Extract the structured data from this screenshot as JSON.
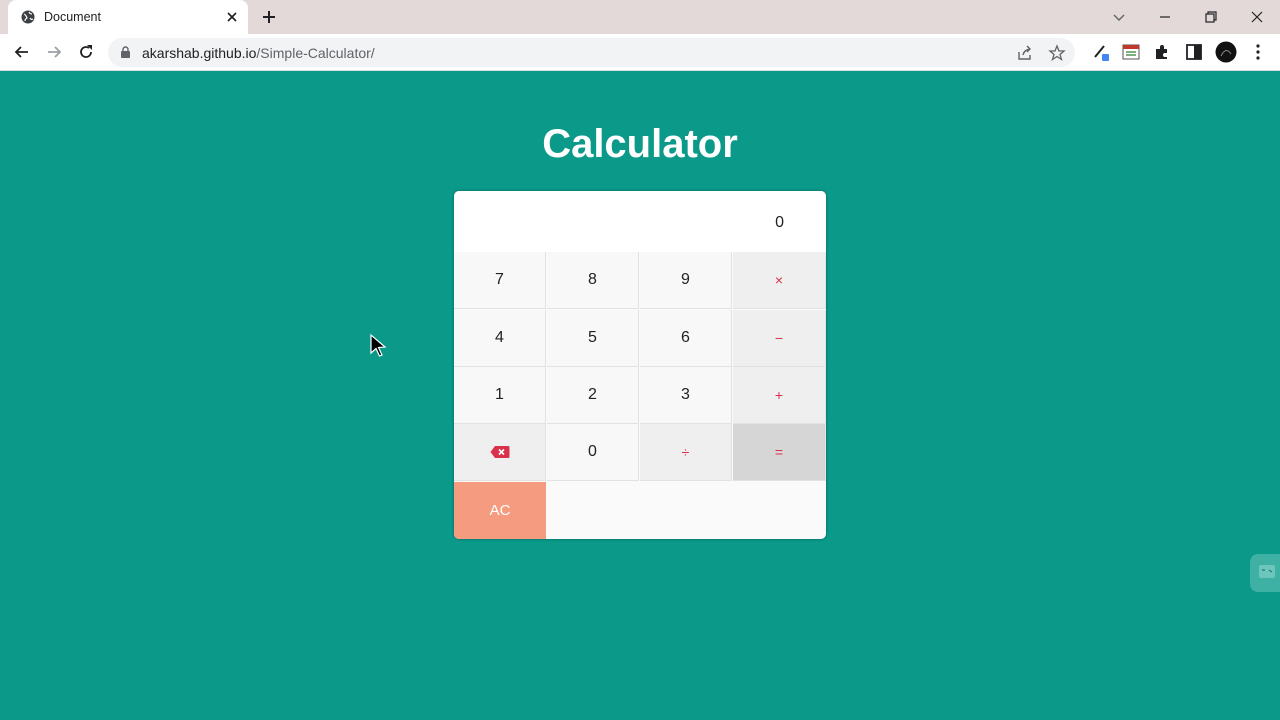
{
  "browser": {
    "tab_title": "Document",
    "url_host": "akarshab.github.io",
    "url_path": "/Simple-Calculator/"
  },
  "page": {
    "title": "Calculator"
  },
  "calculator": {
    "display": "0",
    "keys": {
      "k7": "7",
      "k8": "8",
      "k9": "9",
      "mul": "×",
      "k4": "4",
      "k5": "5",
      "k6": "6",
      "sub": "−",
      "k1": "1",
      "k2": "2",
      "k3": "3",
      "add": "+",
      "k0": "0",
      "div": "÷",
      "eq": "=",
      "ac": "AC"
    },
    "operator_color": "#d9304b",
    "ac_color": "#f59c80"
  },
  "colors": {
    "background": "#0b9a8a",
    "backspace_icon": "#d9304b"
  }
}
